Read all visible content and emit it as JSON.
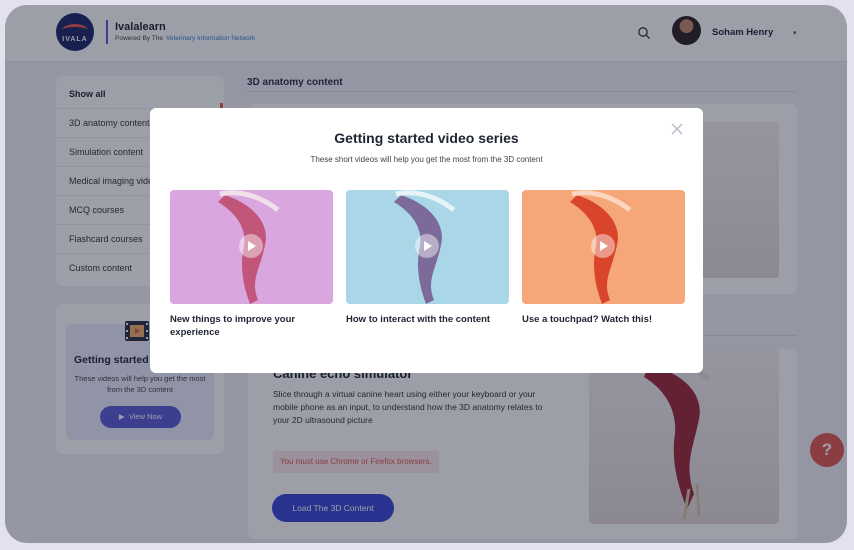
{
  "brand": {
    "logo_text": "IVALA",
    "title": "Ivalalearn",
    "powered_by": "Powered By The",
    "network": "Veterinary Information Network"
  },
  "header": {
    "user_name": "Soham Henry",
    "caret": "▾"
  },
  "sidebar": {
    "items": [
      {
        "label": "Show all"
      },
      {
        "label": "3D anatomy content"
      },
      {
        "label": "Simulation content"
      },
      {
        "label": "Medical imaging videos"
      },
      {
        "label": "MCQ courses"
      },
      {
        "label": "Flashcard courses"
      },
      {
        "label": "Custom content"
      }
    ]
  },
  "getting_started_card": {
    "title": "Getting started video series",
    "description": "These videos will help you get the most from the 3D content",
    "button": "View Now"
  },
  "main": {
    "section_3d": "3D anatomy content",
    "canine": {
      "title": "Canine echo simulator",
      "description": "Slice through a virtual canine heart using either your keyboard or your mobile phone as an input, to understand how the 3D anatomy relates to your 2D ultrasound picture",
      "warning": "You must use Chrome or Firefox browsers.",
      "load_button": "Load The 3D Content"
    }
  },
  "help": {
    "label": "?"
  },
  "modal": {
    "title": "Getting started video series",
    "subtitle": "These short videos will help you get the most from the 3D content",
    "videos": [
      {
        "label": "New things to improve your experience",
        "color": "#d9a6df"
      },
      {
        "label": "How to interact with the content",
        "color": "#a9d7e8"
      },
      {
        "label": "Use a touchpad? Watch this!",
        "color": "#f5a77a"
      }
    ]
  },
  "colors": {
    "accent": "#5a5bd5",
    "danger": "#e05a4f",
    "load_button": "#3a47d5"
  }
}
